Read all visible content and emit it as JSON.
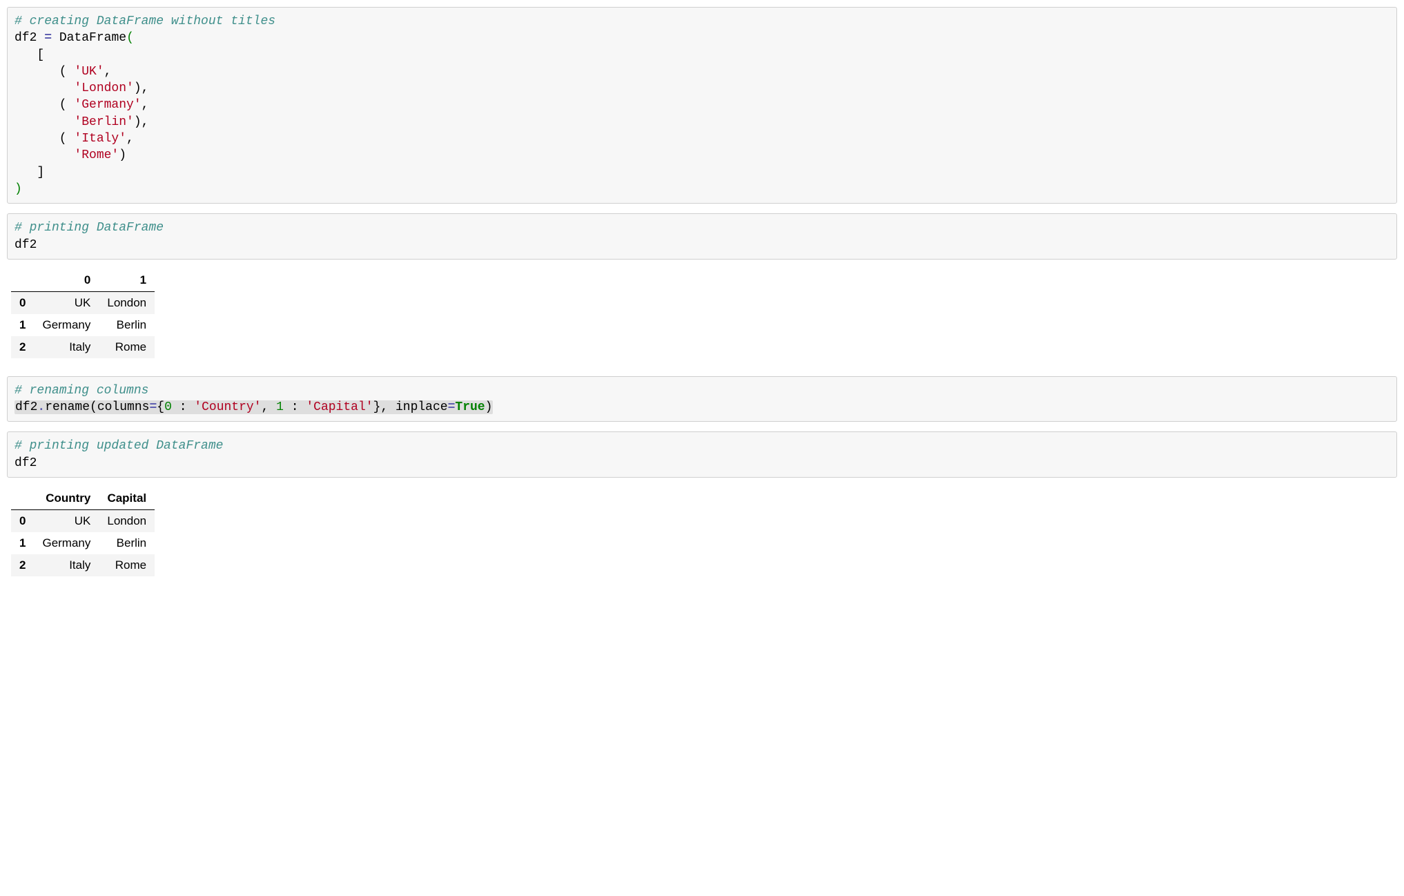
{
  "cell1": {
    "comment": "# creating DataFrame without titles",
    "line1_a": "df2 ",
    "line1_eq": "=",
    "line1_b": " DataFrame",
    "line1_c": "(",
    "line2": "   [",
    "row1_open": "      ( ",
    "row1_s1": "'UK'",
    "row1_sep": ",",
    "row1_pad": "        ",
    "row1_s2": "'London'",
    "row1_close": "),",
    "row2_open": "      ( ",
    "row2_s1": "'Germany'",
    "row2_sep": ",",
    "row2_pad": "        ",
    "row2_s2": "'Berlin'",
    "row2_close": "),",
    "row3_open": "      ( ",
    "row3_s1": "'Italy'",
    "row3_sep": ",",
    "row3_pad": "        ",
    "row3_s2": "'Rome'",
    "row3_close": ")",
    "close_list": "   ]",
    "close_paren": ")"
  },
  "cell2": {
    "comment": "# printing DataFrame",
    "line": "df2"
  },
  "table1": {
    "columns": [
      "0",
      "1"
    ],
    "rows": [
      {
        "idx": "0",
        "c0": "UK",
        "c1": "London"
      },
      {
        "idx": "1",
        "c0": "Germany",
        "c1": "Berlin"
      },
      {
        "idx": "2",
        "c0": "Italy",
        "c1": "Rome"
      }
    ]
  },
  "cell3": {
    "comment": "# renaming columns",
    "part1": "df2",
    "dot": ".",
    "method": "rename(columns",
    "eq": "=",
    "brace_open": "{",
    "k0": "0",
    "sep1": " : ",
    "v0": "'Country'",
    "comma1": ", ",
    "k1": "1",
    "sep2": " : ",
    "v1": "'Capital'",
    "brace_close": "}",
    "comma2": ", inplace",
    "eq2": "=",
    "true": "True",
    "close": ")"
  },
  "cell4": {
    "comment": "# printing updated DataFrame",
    "line": "df2"
  },
  "table2": {
    "columns": [
      "Country",
      "Capital"
    ],
    "rows": [
      {
        "idx": "0",
        "c0": "UK",
        "c1": "London"
      },
      {
        "idx": "1",
        "c0": "Germany",
        "c1": "Berlin"
      },
      {
        "idx": "2",
        "c0": "Italy",
        "c1": "Rome"
      }
    ]
  }
}
